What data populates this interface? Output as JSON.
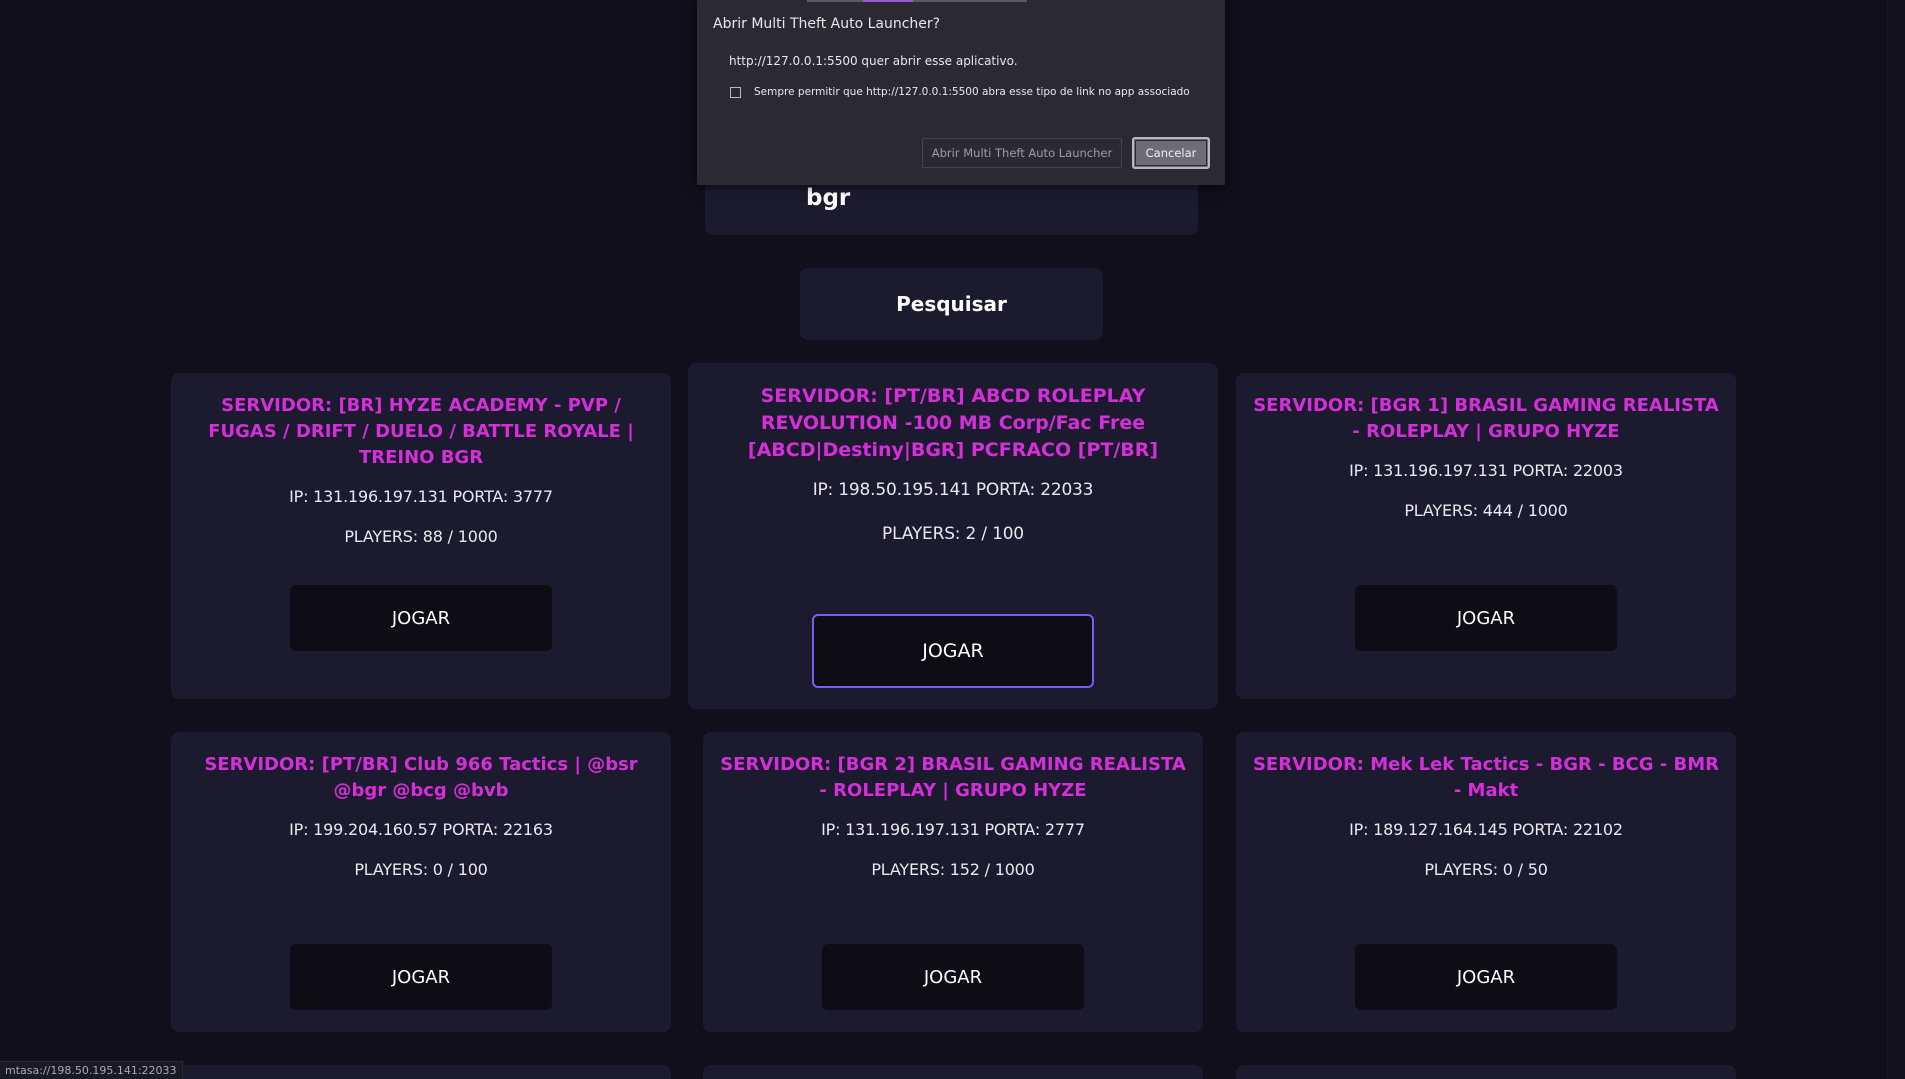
{
  "search": {
    "value": "bgr",
    "button_label": "Pesquisar"
  },
  "dialog": {
    "title": "Abrir Multi Theft Auto Launcher?",
    "message": "http://127.0.0.1:5500 quer abrir esse aplicativo.",
    "checkbox_label": "Sempre permitir que http://127.0.0.1:5500 abra esse tipo de link no app associado",
    "checkbox_checked": false,
    "open_button_label": "Abrir Multi Theft Auto Launcher",
    "cancel_button_label": "Cancelar"
  },
  "servers": [
    {
      "title": "SERVIDOR: [BR] HYZE ACADEMY - PVP / FUGAS / DRIFT / DUELO / BATTLE ROYALE | TREINO BGR",
      "ip_line": "IP: 131.196.197.131 PORTA: 3777",
      "players_line": "PLAYERS: 88 / 1000",
      "play_label": "JOGAR"
    },
    {
      "title": "SERVIDOR: [PT/BR] ABCD ROLEPLAY REVOLUTION -100 MB Corp/Fac Free [ABCD|Destiny|BGR] PCFRACO [PT/BR]",
      "ip_line": "IP: 198.50.195.141 PORTA: 22033",
      "players_line": "PLAYERS: 2 / 100",
      "play_label": "JOGAR"
    },
    {
      "title": "SERVIDOR: [BGR 1] BRASIL GAMING REALISTA - ROLEPLAY | GRUPO HYZE",
      "ip_line": "IP: 131.196.197.131 PORTA: 22003",
      "players_line": "PLAYERS: 444 / 1000",
      "play_label": "JOGAR"
    },
    {
      "title": "SERVIDOR: [PT/BR] Club 966 Tactics | @bsr @bgr @bcg @bvb",
      "ip_line": "IP: 199.204.160.57 PORTA: 22163",
      "players_line": "PLAYERS: 0 / 100",
      "play_label": "JOGAR"
    },
    {
      "title": "SERVIDOR: [BGR 2] BRASIL GAMING REALISTA - ROLEPLAY | GRUPO HYZE",
      "ip_line": "IP: 131.196.197.131 PORTA: 2777",
      "players_line": "PLAYERS: 152 / 1000",
      "play_label": "JOGAR"
    },
    {
      "title": "SERVIDOR: Mek Lek Tactics - BGR - BCG - BMR - Makt",
      "ip_line": "IP: 189.127.164.145 PORTA: 22102",
      "players_line": "PLAYERS: 0 / 50",
      "play_label": "JOGAR"
    }
  ],
  "status_bar": {
    "url": "mtasa://198.50.195.141:22033"
  },
  "colors": {
    "background": "#100f1b",
    "card": "#1c1a2e",
    "title_accent": "#d42fd9",
    "focus_ring": "#7b5cf0"
  }
}
